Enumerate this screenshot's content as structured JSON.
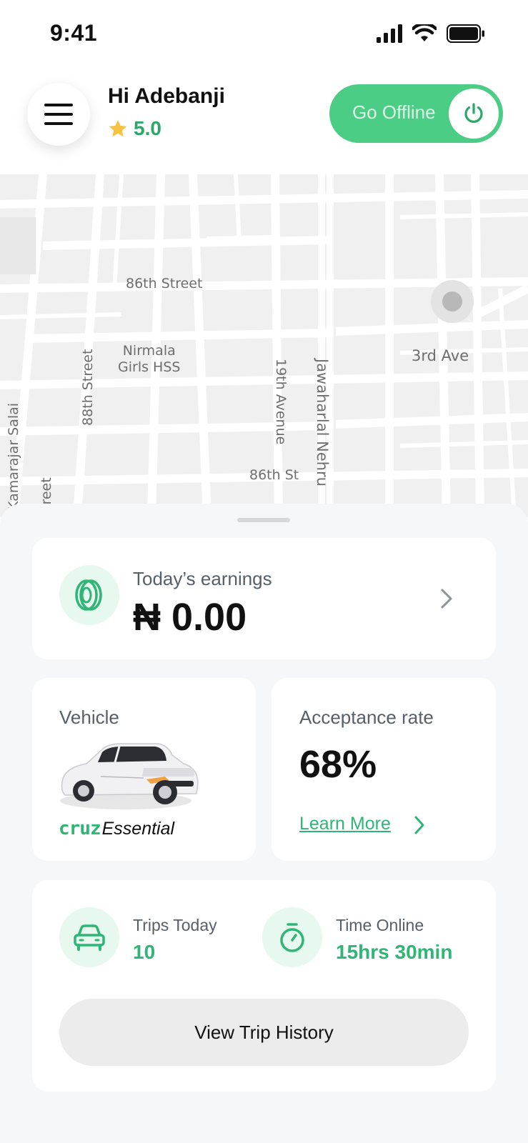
{
  "status_bar": {
    "time": "9:41"
  },
  "header": {
    "greeting": "Hi Adebanji",
    "rating": "5.0",
    "toggle_label": "Go Offline"
  },
  "map": {
    "labels": {
      "street_86th": "86th Street",
      "nirmala_line1": "Nirmala",
      "nirmala_line2": "Girls HSS",
      "third_ave": "3rd Ave",
      "street_88th": "88th Street",
      "avenue_19th": "19th Avenue",
      "jawaharlal": "Jawaharlal Nehru",
      "kamarajar": "Kamarajar Salai",
      "street_partial": "treet",
      "st_86th": "86th St"
    }
  },
  "earnings": {
    "label": "Today’s earnings",
    "value": "₦ 0.00"
  },
  "vehicle": {
    "label": "Vehicle",
    "brand": "cruz",
    "tier": "Essential"
  },
  "acceptance": {
    "label": "Acceptance rate",
    "value": "68%",
    "link": "Learn More"
  },
  "stats": {
    "trips_label": "Trips Today",
    "trips_value": "10",
    "time_label": "Time Online",
    "time_value": "15hrs 30min",
    "history_button": "View Trip History"
  },
  "colors": {
    "accent": "#2fb676",
    "toggle": "#4ccd86",
    "icon_bg": "#e7f8ee",
    "rating_star": "#f5c242"
  }
}
